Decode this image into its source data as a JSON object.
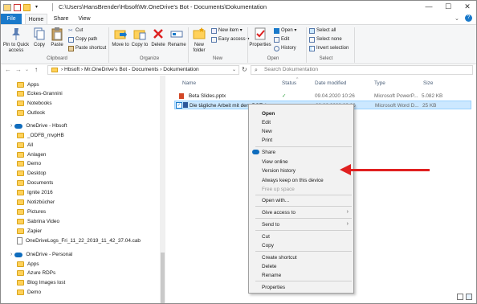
{
  "title_bar": {
    "path": "C:\\Users\\HansBrender\\Hbsoft\\Mr.OneDrive's Bot - Documents\\Dokumentation",
    "minimize": "—",
    "maximize": "☐",
    "close": "✕"
  },
  "tabs": {
    "file": "File",
    "home": "Home",
    "share": "Share",
    "view": "View"
  },
  "ribbon": {
    "pin": "Pin to Quick access",
    "copy": "Copy",
    "paste": "Paste",
    "cut": "Cut",
    "copy_path": "Copy path",
    "paste_shortcut": "Paste shortcut",
    "clipboard": "Clipboard",
    "move_to": "Move to",
    "copy_to": "Copy to",
    "delete": "Delete",
    "rename": "Rename",
    "organize": "Organize",
    "new_folder": "New folder",
    "new_item": "New item ▾",
    "easy_access": "Easy access ▾",
    "new": "New",
    "properties": "Properties",
    "open": "Open ▾",
    "edit": "Edit",
    "history": "History",
    "open_group": "Open",
    "select_all": "Select all",
    "select_none": "Select none",
    "invert_selection": "Invert selection",
    "select": "Select"
  },
  "address": {
    "breadcrumb": "›  Hbsoft  ›  Mr.OneDrive's Bot - Documents  ›  Dokumentation",
    "search_placeholder": "Search Dokumentation"
  },
  "nav": {
    "items": [
      {
        "label": "Apps",
        "type": "folder"
      },
      {
        "label": "Eckes-Grannini",
        "type": "folder"
      },
      {
        "label": "Notebooks",
        "type": "folder"
      },
      {
        "label": "Outlook",
        "type": "folder"
      },
      {
        "label": "OneDrive - Hbsoft",
        "type": "cloud"
      },
      {
        "label": "_ODFB_mvpHB",
        "type": "folder"
      },
      {
        "label": "All",
        "type": "folder"
      },
      {
        "label": "Anlagen",
        "type": "folder"
      },
      {
        "label": "Demo",
        "type": "folder"
      },
      {
        "label": "Desktop",
        "type": "folder"
      },
      {
        "label": "Documents",
        "type": "folder"
      },
      {
        "label": "Ignite 2016",
        "type": "folder"
      },
      {
        "label": "Notizbücher",
        "type": "folder"
      },
      {
        "label": "Pictures",
        "type": "folder"
      },
      {
        "label": "Sabrina Video",
        "type": "folder"
      },
      {
        "label": "Zapier",
        "type": "folder"
      },
      {
        "label": "OneDriveLogs_Fri_11_22_2019_11_42_37.04.cab",
        "type": "file"
      },
      {
        "label": "OneDrive - Personal",
        "type": "cloud"
      },
      {
        "label": "Apps",
        "type": "folder"
      },
      {
        "label": "Azure RDPs",
        "type": "folder"
      },
      {
        "label": "Blog Images lost",
        "type": "folder"
      },
      {
        "label": "Demo",
        "type": "folder"
      }
    ]
  },
  "list": {
    "headers": {
      "name": "Name",
      "status": "Status",
      "date": "Date modified",
      "type": "Type",
      "size": "Size"
    },
    "rows": [
      {
        "name": "Beta Slides.pptx",
        "status": "✓",
        "date": "09.04.2020 10:26",
        "type": "Microsoft PowerP...",
        "size": "5.082 KB"
      },
      {
        "name": "Die tägliche Arbeit mit dem BOT.docx",
        "status": "○",
        "date": "29.02.2020 09:26",
        "type": "Microsoft Word D...",
        "size": "25 KB"
      }
    ]
  },
  "context_menu": {
    "open": "Open",
    "edit": "Edit",
    "new": "New",
    "print": "Print",
    "share": "Share",
    "view_online": "View online",
    "version_history": "Version history",
    "always_keep": "Always keep on this device",
    "free_up_space": "Free up space",
    "open_with": "Open with...",
    "give_access": "Give access to",
    "send_to": "Send to",
    "cut": "Cut",
    "copy": "Copy",
    "create_shortcut": "Create shortcut",
    "delete": "Delete",
    "rename": "Rename",
    "properties": "Properties"
  },
  "colors": {
    "accent": "#1979ca",
    "selection": "#cce8ff",
    "arrow": "#e02020",
    "folder": "#ffd15a"
  }
}
